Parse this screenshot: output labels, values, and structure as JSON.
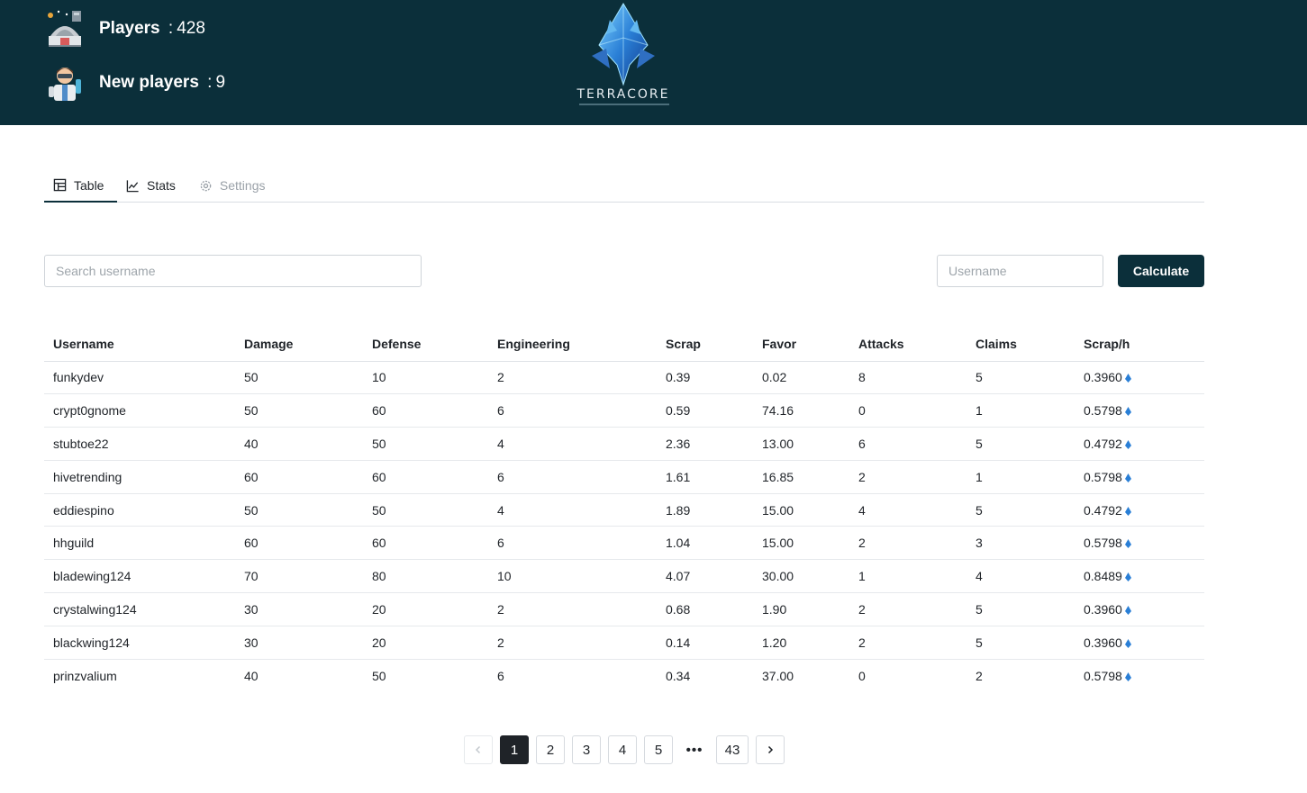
{
  "header": {
    "players_label": "Players",
    "players_value": "428",
    "new_players_label": "New players",
    "new_players_value": "9",
    "logo_text": "TERRACORE"
  },
  "tabs": [
    {
      "label": "Table",
      "icon": "table-icon",
      "active": true
    },
    {
      "label": "Stats",
      "icon": "chart-icon",
      "active": false
    },
    {
      "label": "Settings",
      "icon": "gear-icon",
      "disabled": true
    }
  ],
  "search": {
    "placeholder": "Search username"
  },
  "calculator": {
    "username_placeholder": "Username",
    "button_label": "Calculate"
  },
  "table": {
    "headers": [
      "Username",
      "Damage",
      "Defense",
      "Engineering",
      "Scrap",
      "Favor",
      "Attacks",
      "Claims",
      "Scrap/h"
    ],
    "rows": [
      [
        "funkydev",
        "50",
        "10",
        "2",
        "0.39",
        "0.02",
        "8",
        "5",
        "0.3960"
      ],
      [
        "crypt0gnome",
        "50",
        "60",
        "6",
        "0.59",
        "74.16",
        "0",
        "1",
        "0.5798"
      ],
      [
        "stubtoe22",
        "40",
        "50",
        "4",
        "2.36",
        "13.00",
        "6",
        "5",
        "0.4792"
      ],
      [
        "hivetrending",
        "60",
        "60",
        "6",
        "1.61",
        "16.85",
        "2",
        "1",
        "0.5798"
      ],
      [
        "eddiespino",
        "50",
        "50",
        "4",
        "1.89",
        "15.00",
        "4",
        "5",
        "0.4792"
      ],
      [
        "hhguild",
        "60",
        "60",
        "6",
        "1.04",
        "15.00",
        "2",
        "3",
        "0.5798"
      ],
      [
        "bladewing124",
        "70",
        "80",
        "10",
        "4.07",
        "30.00",
        "1",
        "4",
        "0.8489"
      ],
      [
        "crystalwing124",
        "30",
        "20",
        "2",
        "0.68",
        "1.90",
        "2",
        "5",
        "0.3960"
      ],
      [
        "blackwing124",
        "30",
        "20",
        "2",
        "0.14",
        "1.20",
        "2",
        "5",
        "0.3960"
      ],
      [
        "prinzvalium",
        "40",
        "50",
        "6",
        "0.34",
        "37.00",
        "0",
        "2",
        "0.5798"
      ]
    ]
  },
  "pagination": {
    "pages": [
      "1",
      "2",
      "3",
      "4",
      "5"
    ],
    "ellipsis": "•••",
    "last": "43",
    "current": "1"
  },
  "colors": {
    "header_bg": "#0b2f3a",
    "button_bg": "#0b2f3a",
    "gem_blue": "#2a7fd6"
  }
}
